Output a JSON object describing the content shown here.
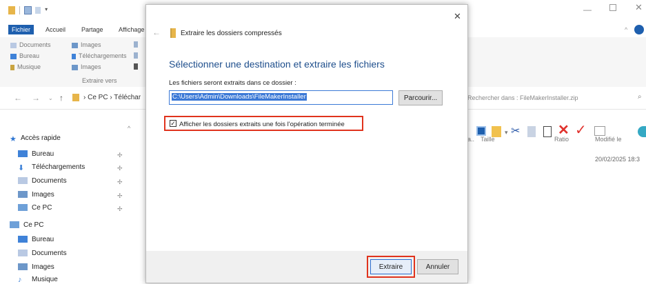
{
  "explorer": {
    "ribbon_tabs": [
      "Fichier",
      "Accueil",
      "Partage",
      "Affichage"
    ],
    "ribbon": {
      "col1": [
        "Documents",
        "Bureau",
        "Musique"
      ],
      "col2": [
        "Images",
        "Téléchargements",
        "Images"
      ],
      "extract_group_label": "Extraire vers"
    },
    "breadcrumb": [
      "Ce PC",
      "Téléchar"
    ],
    "search_placeholder": "Rechercher dans : FileMakerInstaller.zip",
    "columns": [
      "Taille",
      "Ratio",
      "Modifié le"
    ],
    "row_date": "20/02/2025 18:3",
    "sidebar": {
      "quick_access": "Accès rapide",
      "quick_items": [
        "Bureau",
        "Téléchargements",
        "Documents",
        "Images",
        "Ce PC"
      ],
      "this_pc": "Ce PC",
      "pc_items": [
        "Bureau",
        "Documents",
        "Images",
        "Musique"
      ]
    }
  },
  "dialog": {
    "title": "Extraire les dossiers compressés",
    "heading": "Sélectionner une destination et extraire les fichiers",
    "path_label": "Les fichiers seront extraits dans ce dossier :",
    "path_value": "C:\\Users\\Admin\\Downloads\\FileMakerInstaller",
    "browse_label": "Parcourir...",
    "checkbox_label": "Afficher les dossiers extraits une fois l'opération terminée",
    "checkbox_checked": true,
    "extract_label": "Extraire",
    "cancel_label": "Annuler"
  },
  "colors": {
    "accent_blue": "#1e5fae",
    "heading_blue": "#1e4e8c",
    "highlight_red": "#e0321c",
    "selection_blue": "#3a78d6"
  }
}
